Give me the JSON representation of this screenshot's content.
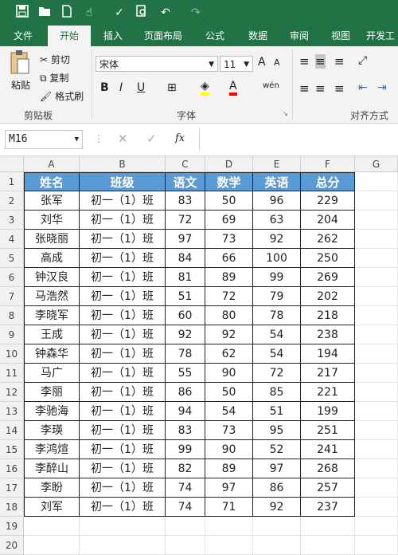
{
  "qat": {
    "save_icon": "save-icon",
    "open_icon": "folder-open-icon",
    "new_icon": "new-file-icon",
    "touch_icon": "touch-mode-icon",
    "spell_icon": "spelling-icon",
    "preview_icon": "print-preview-icon",
    "undo_icon": "undo-icon",
    "redo_icon": "redo-icon"
  },
  "tabs": [
    "文件",
    "开始",
    "插入",
    "页面布局",
    "公式",
    "数据",
    "审阅",
    "视图",
    "开发工"
  ],
  "active_tab": "开始",
  "ribbon": {
    "paste": "粘贴",
    "cut": "剪切",
    "copy": "复制",
    "format_painter": "格式刷",
    "clipboard_group": "剪贴板",
    "font_name": "宋体",
    "font_size": "11",
    "font_group": "字体",
    "bold": "B",
    "italic": "I",
    "underline": "U",
    "grow_font": "A",
    "shrink_font": "A",
    "font_color": "A",
    "wen": "wén",
    "align_group": "对齐方式"
  },
  "formula_bar": {
    "name_box": "M16",
    "fx": "fx",
    "content": ""
  },
  "grid": {
    "columns": [
      "A",
      "B",
      "C",
      "D",
      "E",
      "F",
      "G"
    ],
    "rows": [
      "1",
      "2",
      "3",
      "4",
      "5",
      "6",
      "7",
      "8",
      "9",
      "10",
      "11",
      "12",
      "13",
      "14",
      "15",
      "16",
      "17",
      "18",
      "19",
      "20"
    ],
    "header": [
      "姓名",
      "班级",
      "语文",
      "数学",
      "英语",
      "总分"
    ],
    "records": [
      [
        "张军",
        "初一（1）班",
        "83",
        "50",
        "96",
        "229"
      ],
      [
        "刘华",
        "初一（1）班",
        "72",
        "69",
        "63",
        "204"
      ],
      [
        "张晓丽",
        "初一（1）班",
        "97",
        "73",
        "92",
        "262"
      ],
      [
        "高成",
        "初一（1）班",
        "84",
        "66",
        "100",
        "250"
      ],
      [
        "钟汉良",
        "初一（1）班",
        "81",
        "89",
        "99",
        "269"
      ],
      [
        "马浩然",
        "初一（1）班",
        "51",
        "72",
        "79",
        "202"
      ],
      [
        "李晓军",
        "初一（1）班",
        "60",
        "80",
        "78",
        "218"
      ],
      [
        "王成",
        "初一（1）班",
        "92",
        "92",
        "54",
        "238"
      ],
      [
        "钟森华",
        "初一（1）班",
        "78",
        "62",
        "54",
        "194"
      ],
      [
        "马广",
        "初一（1）班",
        "55",
        "90",
        "72",
        "217"
      ],
      [
        "李丽",
        "初一（1）班",
        "86",
        "50",
        "85",
        "221"
      ],
      [
        "李驰海",
        "初一（1）班",
        "94",
        "54",
        "51",
        "199"
      ],
      [
        "李瑛",
        "初一（1）班",
        "83",
        "73",
        "95",
        "251"
      ],
      [
        "李鸿煊",
        "初一（1）班",
        "99",
        "90",
        "52",
        "241"
      ],
      [
        "李醉山",
        "初一（1）班",
        "82",
        "89",
        "97",
        "268"
      ],
      [
        "李盼",
        "初一（1）班",
        "74",
        "97",
        "86",
        "257"
      ],
      [
        "刘军",
        "初一（1）班",
        "74",
        "71",
        "92",
        "237"
      ]
    ]
  },
  "colors": {
    "header_fill": "#5b9bd5",
    "ribbon_green": "#217346"
  }
}
